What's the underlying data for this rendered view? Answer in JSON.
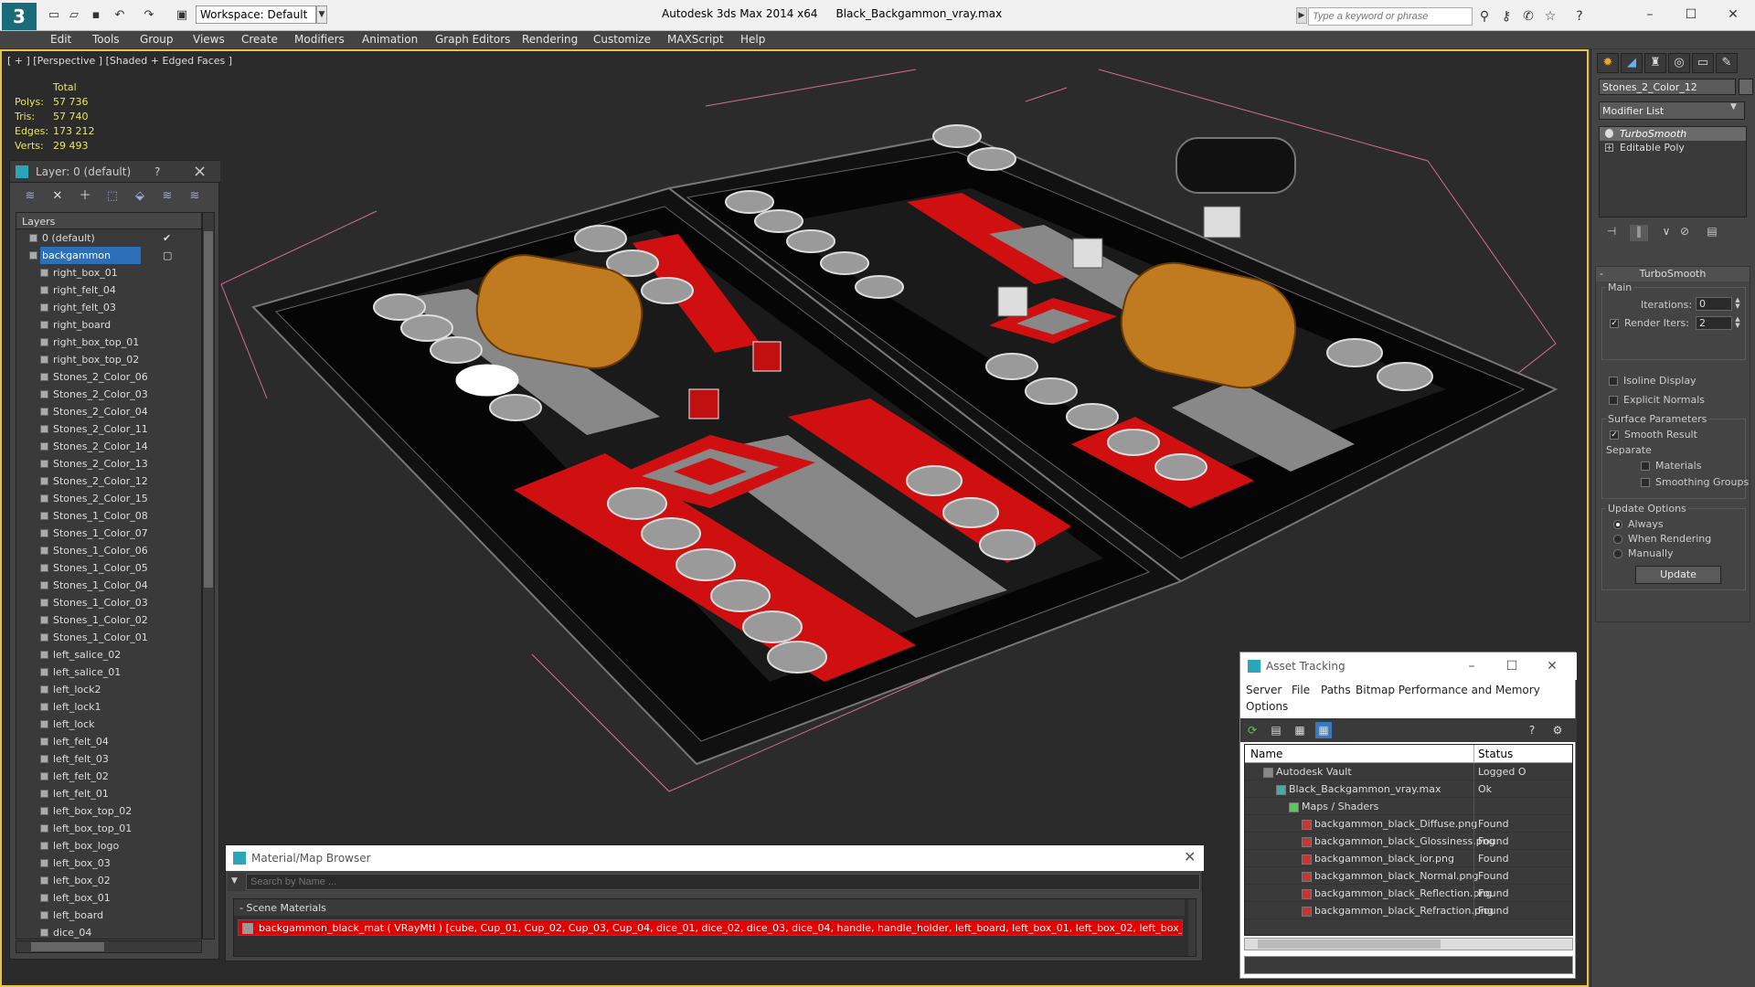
{
  "app": {
    "workspace": "Workspace: Default",
    "title_app": "Autodesk 3ds Max  2014 x64",
    "title_file": "Black_Backgammon_vray.max",
    "search_placeholder": "Type a keyword or phrase"
  },
  "menu": [
    "Edit",
    "Tools",
    "Group",
    "Views",
    "Create",
    "Modifiers",
    "Animation",
    "Graph Editors",
    "Rendering",
    "Customize",
    "MAXScript",
    "Help"
  ],
  "viewport": {
    "label": "[ + ] [Perspective ] [Shaded + Edged Faces ]",
    "stats": {
      "header": "Total",
      "rows": [
        {
          "label": "Polys:",
          "value": "57 736"
        },
        {
          "label": "Tris:",
          "value": "57 740"
        },
        {
          "label": "Edges:",
          "value": "173 212"
        },
        {
          "label": "Verts:",
          "value": "29 493"
        }
      ]
    }
  },
  "layer_panel": {
    "title": "Layer: 0 (default)",
    "help": "?",
    "column_header": "Layers",
    "items": [
      {
        "name": "0 (default)",
        "level": 0,
        "checked": true
      },
      {
        "name": "backgammon",
        "level": 0,
        "selected": true
      },
      {
        "name": "right_box_01",
        "level": 1
      },
      {
        "name": "right_felt_04",
        "level": 1
      },
      {
        "name": "right_felt_03",
        "level": 1
      },
      {
        "name": "right_board",
        "level": 1
      },
      {
        "name": "right_box_top_01",
        "level": 1
      },
      {
        "name": "right_box_top_02",
        "level": 1
      },
      {
        "name": "Stones_2_Color_06",
        "level": 1
      },
      {
        "name": "Stones_2_Color_03",
        "level": 1
      },
      {
        "name": "Stones_2_Color_04",
        "level": 1
      },
      {
        "name": "Stones_2_Color_11",
        "level": 1
      },
      {
        "name": "Stones_2_Color_14",
        "level": 1
      },
      {
        "name": "Stones_2_Color_13",
        "level": 1
      },
      {
        "name": "Stones_2_Color_12",
        "level": 1
      },
      {
        "name": "Stones_2_Color_15",
        "level": 1
      },
      {
        "name": "Stones_1_Color_08",
        "level": 1
      },
      {
        "name": "Stones_1_Color_07",
        "level": 1
      },
      {
        "name": "Stones_1_Color_06",
        "level": 1
      },
      {
        "name": "Stones_1_Color_05",
        "level": 1
      },
      {
        "name": "Stones_1_Color_04",
        "level": 1
      },
      {
        "name": "Stones_1_Color_03",
        "level": 1
      },
      {
        "name": "Stones_1_Color_02",
        "level": 1
      },
      {
        "name": "Stones_1_Color_01",
        "level": 1
      },
      {
        "name": "left_salice_02",
        "level": 1
      },
      {
        "name": "left_salice_01",
        "level": 1
      },
      {
        "name": "left_lock2",
        "level": 1
      },
      {
        "name": "left_lock1",
        "level": 1
      },
      {
        "name": "left_lock",
        "level": 1
      },
      {
        "name": "left_felt_04",
        "level": 1
      },
      {
        "name": "left_felt_03",
        "level": 1
      },
      {
        "name": "left_felt_02",
        "level": 1
      },
      {
        "name": "left_felt_01",
        "level": 1
      },
      {
        "name": "left_box_top_02",
        "level": 1
      },
      {
        "name": "left_box_top_01",
        "level": 1
      },
      {
        "name": "left_box_logo",
        "level": 1
      },
      {
        "name": "left_box_03",
        "level": 1
      },
      {
        "name": "left_box_02",
        "level": 1
      },
      {
        "name": "left_box_01",
        "level": 1
      },
      {
        "name": "left_board",
        "level": 1
      },
      {
        "name": "dice_04",
        "level": 1
      }
    ]
  },
  "command_panel": {
    "object_name": "Stones_2_Color_12",
    "modifier_list": "Modifier List",
    "stack": [
      {
        "name": "TurboSmooth",
        "active": true
      },
      {
        "name": "Editable Poly",
        "active": false
      }
    ],
    "rollout": {
      "title": "TurboSmooth",
      "main_group": "Main",
      "iterations_label": "Iterations:",
      "iterations_value": "0",
      "render_iters_label": "Render Iters:",
      "render_iters_value": "2",
      "isoline": "Isoline Display",
      "explicit": "Explicit Normals",
      "surface_group": "Surface Parameters",
      "smooth_result": "Smooth Result",
      "separate": "Separate",
      "materials": "Materials",
      "smoothing_groups": "Smoothing Groups",
      "update_group": "Update Options",
      "always": "Always",
      "when_rendering": "When Rendering",
      "manually": "Manually",
      "update_btn": "Update"
    }
  },
  "asset_tracking": {
    "title": "Asset Tracking",
    "menu": [
      "Server",
      "File",
      "Paths",
      "Bitmap Performance and Memory",
      "Options"
    ],
    "columns": [
      "Name",
      "Status"
    ],
    "rows": [
      {
        "name": "Autodesk Vault",
        "status": "Logged O",
        "indent": 1
      },
      {
        "name": "Black_Backgammon_vray.max",
        "status": "Ok",
        "indent": 2
      },
      {
        "name": "Maps / Shaders",
        "status": "",
        "indent": 3
      },
      {
        "name": "backgammon_black_Diffuse.png",
        "status": "Found",
        "indent": 4
      },
      {
        "name": "backgammon_black_Glossiness.png",
        "status": "Found",
        "indent": 4
      },
      {
        "name": "backgammon_black_ior.png",
        "status": "Found",
        "indent": 4
      },
      {
        "name": "backgammon_black_Normal.png",
        "status": "Found",
        "indent": 4
      },
      {
        "name": "backgammon_black_Reflection.png",
        "status": "Found",
        "indent": 4
      },
      {
        "name": "backgammon_black_Refraction.png",
        "status": "Found",
        "indent": 4
      }
    ]
  },
  "material_browser": {
    "title": "Material/Map Browser",
    "search_placeholder": "Search by Name ...",
    "group": "- Scene Materials",
    "row": "backgammon_black_mat  ( VRayMtl ) [cube, Cup_01, Cup_02, Cup_03, Cup_04, dice_01, dice_02, dice_03, dice_04, handle, handle_holder, left_board, left_box_01, left_box_02, left_box_03, left_bo..."
  },
  "colors": {
    "viewport_border": "#e8c34a",
    "stats_text": "#e8e65a",
    "felt_red": "#d01010",
    "felt_gray": "#8a8a8a",
    "selection": "#2c6fb8"
  }
}
